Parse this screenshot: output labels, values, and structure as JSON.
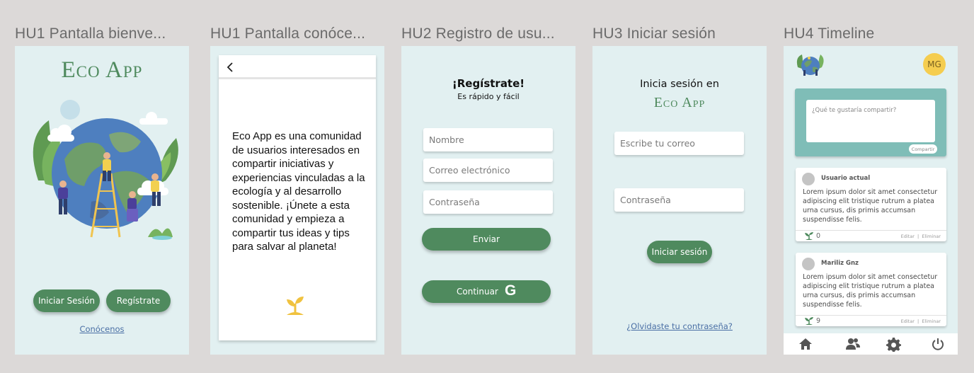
{
  "frames": [
    {
      "title": "HU1 Pantalla bienve..."
    },
    {
      "title": "HU1 Pantalla conóce..."
    },
    {
      "title": "HU2 Registro de usu..."
    },
    {
      "title": "HU3 Iniciar sesión"
    },
    {
      "title": "HU4 Timeline"
    }
  ],
  "welcome": {
    "logo": "Eco App",
    "login_button": "Iniciar Sesión",
    "register_button": "Regístrate",
    "about_link": "Conócenos"
  },
  "about": {
    "back_icon": "chevron-left-icon",
    "text": "Eco App es una comunidad de usuarios interesados en compartir iniciativas y experiencias vinculadas a la ecología y al desarrollo sostenible. ¡Únete a esta comunidad y empieza a compartir tus ideas y tips para salvar al planeta!",
    "plant_icon": "sprout-icon"
  },
  "register": {
    "title": "¡Regístrate!",
    "subtitle": "Es rápido y fácil",
    "name_placeholder": "Nombre",
    "email_placeholder": "Correo electrónico",
    "password_placeholder": "Contraseña",
    "submit_button": "Enviar",
    "google_button": "Continuar",
    "google_icon": "google-icon"
  },
  "login": {
    "title": "Inicia sesión en",
    "logo": "Eco App",
    "email_placeholder": "Escribe tu correo",
    "password_placeholder": "Contraseña",
    "submit_button": "Iniciar sesión",
    "forgot_link": "¿Olvidaste tu contraseña?"
  },
  "timeline": {
    "avatar_initials": "MG",
    "composer_placeholder": "¿Qué te gustaría compartir?",
    "share_button": "Compartir",
    "posts": [
      {
        "user": "Usuario actual",
        "text": "Lorem ipsum dolor sit amet consectetur adipiscing elit tristique rutrum a platea urna cursus, dis primis accumsan suspendisse felis.",
        "count": "0",
        "edit": "Editar",
        "delete": "Eliminar"
      },
      {
        "user": "Mariliz Gnz",
        "text": "Lorem ipsum dolor sit amet consectetur adipiscing elit tristique rutrum a platea urna cursus, dis primis accumsan suspendisse felis.",
        "count": "9",
        "edit": "Editar",
        "delete": "Eliminar"
      }
    ],
    "nav": [
      "home-icon",
      "users-icon",
      "gear-icon",
      "power-icon"
    ]
  },
  "colors": {
    "background": "#dcd9d8",
    "frame": "#e2f0f1",
    "primary_green": "#4f8a5e",
    "teal": "#7fbdb7",
    "avatar_yellow": "#f5cd4f"
  }
}
